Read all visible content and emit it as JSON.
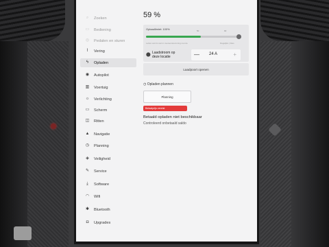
{
  "charge": {
    "percent": "59 %"
  },
  "limit": {
    "label": "Oplaadlimiet: 100%",
    "value_percent": 100,
    "fill_percent": 59,
    "ticks": [
      "50",
      "90"
    ],
    "note_left": "Letten accu's wel in overeenstemming met de",
    "note_right": "Dagelijks | Reis"
  },
  "current": {
    "label": "Laadstroom op deze locatie",
    "value": "24 A",
    "minus": "—",
    "plus": "+"
  },
  "charge_port_button": "Laadpoort openen",
  "plan": {
    "header": "Opladen plannen",
    "button": "Planning"
  },
  "error": {
    "badge": "Betaalprijs vereist",
    "title": "Betaald opladen niet beschikbaar",
    "subtitle": "Controleerd onbetaald saldo"
  },
  "sidebar": {
    "items": [
      {
        "label": "Zoeken",
        "icon": "search-icon",
        "glyph": "⌕",
        "dim": true
      },
      {
        "label": "Bediening",
        "icon": "car-icon",
        "glyph": "▭",
        "dim": true
      },
      {
        "label": "Pedalen en sturen",
        "icon": "steering-icon",
        "glyph": "◎",
        "dim": true
      },
      {
        "label": "Vering",
        "icon": "suspension-icon",
        "glyph": "⌇",
        "dim": false
      },
      {
        "label": "Opladen",
        "icon": "bolt-icon",
        "glyph": "ϟ",
        "dim": false
      },
      {
        "label": "Autopilot",
        "icon": "autopilot-icon",
        "glyph": "◉",
        "dim": false
      },
      {
        "label": "Voertuig",
        "icon": "vehicle-icon",
        "glyph": "▥",
        "dim": false
      },
      {
        "label": "Verlichting",
        "icon": "light-icon",
        "glyph": "☼",
        "dim": false
      },
      {
        "label": "Scherm",
        "icon": "display-icon",
        "glyph": "▭",
        "dim": false
      },
      {
        "label": "Ritten",
        "icon": "trips-icon",
        "glyph": "◫",
        "dim": false
      },
      {
        "label": "Navigatie",
        "icon": "navigation-icon",
        "glyph": "▲",
        "dim": false
      },
      {
        "label": "Planning",
        "icon": "schedule-icon",
        "glyph": "◷",
        "dim": false
      },
      {
        "label": "Veiligheid",
        "icon": "shield-icon",
        "glyph": "◈",
        "dim": false
      },
      {
        "label": "Service",
        "icon": "wrench-icon",
        "glyph": "✎",
        "dim": false
      },
      {
        "label": "Software",
        "icon": "download-icon",
        "glyph": "⤓",
        "dim": false
      },
      {
        "label": "Wifi",
        "icon": "wifi-icon",
        "glyph": "◠",
        "dim": false
      },
      {
        "label": "Bluetooth",
        "icon": "bluetooth-icon",
        "glyph": "✱",
        "dim": false
      },
      {
        "label": "Upgrades",
        "icon": "bag-icon",
        "glyph": "◘",
        "dim": false
      }
    ],
    "active_index": 4
  }
}
